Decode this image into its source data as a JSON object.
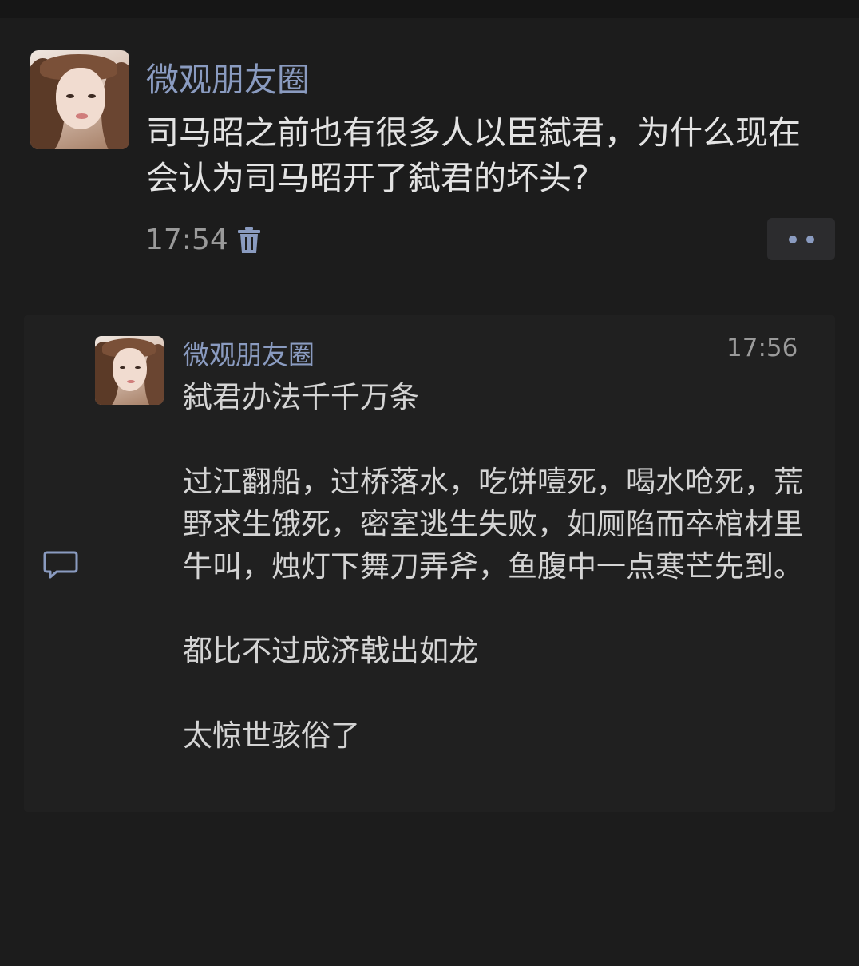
{
  "post": {
    "author": "微观朋友圈",
    "text": "司马昭之前也有很多人以臣弑君，为什么现在会认为司马昭开了弑君的坏头?",
    "time": "17:54",
    "avatar_icon": "avatar-photo-icon",
    "delete_icon": "trash-icon",
    "more_icon": "more-dots-icon"
  },
  "comment": {
    "author": "微观朋友圈",
    "time": "17:56",
    "text": "弑君办法千千万条\n\n过江翻船，过桥落水，吃饼噎死，喝水呛死，荒野求生饿死，密室逃生失败，如厕陷而卒棺材里牛叫，烛灯下舞刀弄斧，鱼腹中一点寒芒先到。\n\n都比不过成济戟出如龙\n\n太惊世骇俗了",
    "icon": "comment-bubble-icon"
  },
  "colors": {
    "background": "#1c1c1c",
    "panel": "#202020",
    "name_link": "#8a9bc0",
    "text": "#e3e3e3",
    "muted": "#9a9a9a"
  }
}
